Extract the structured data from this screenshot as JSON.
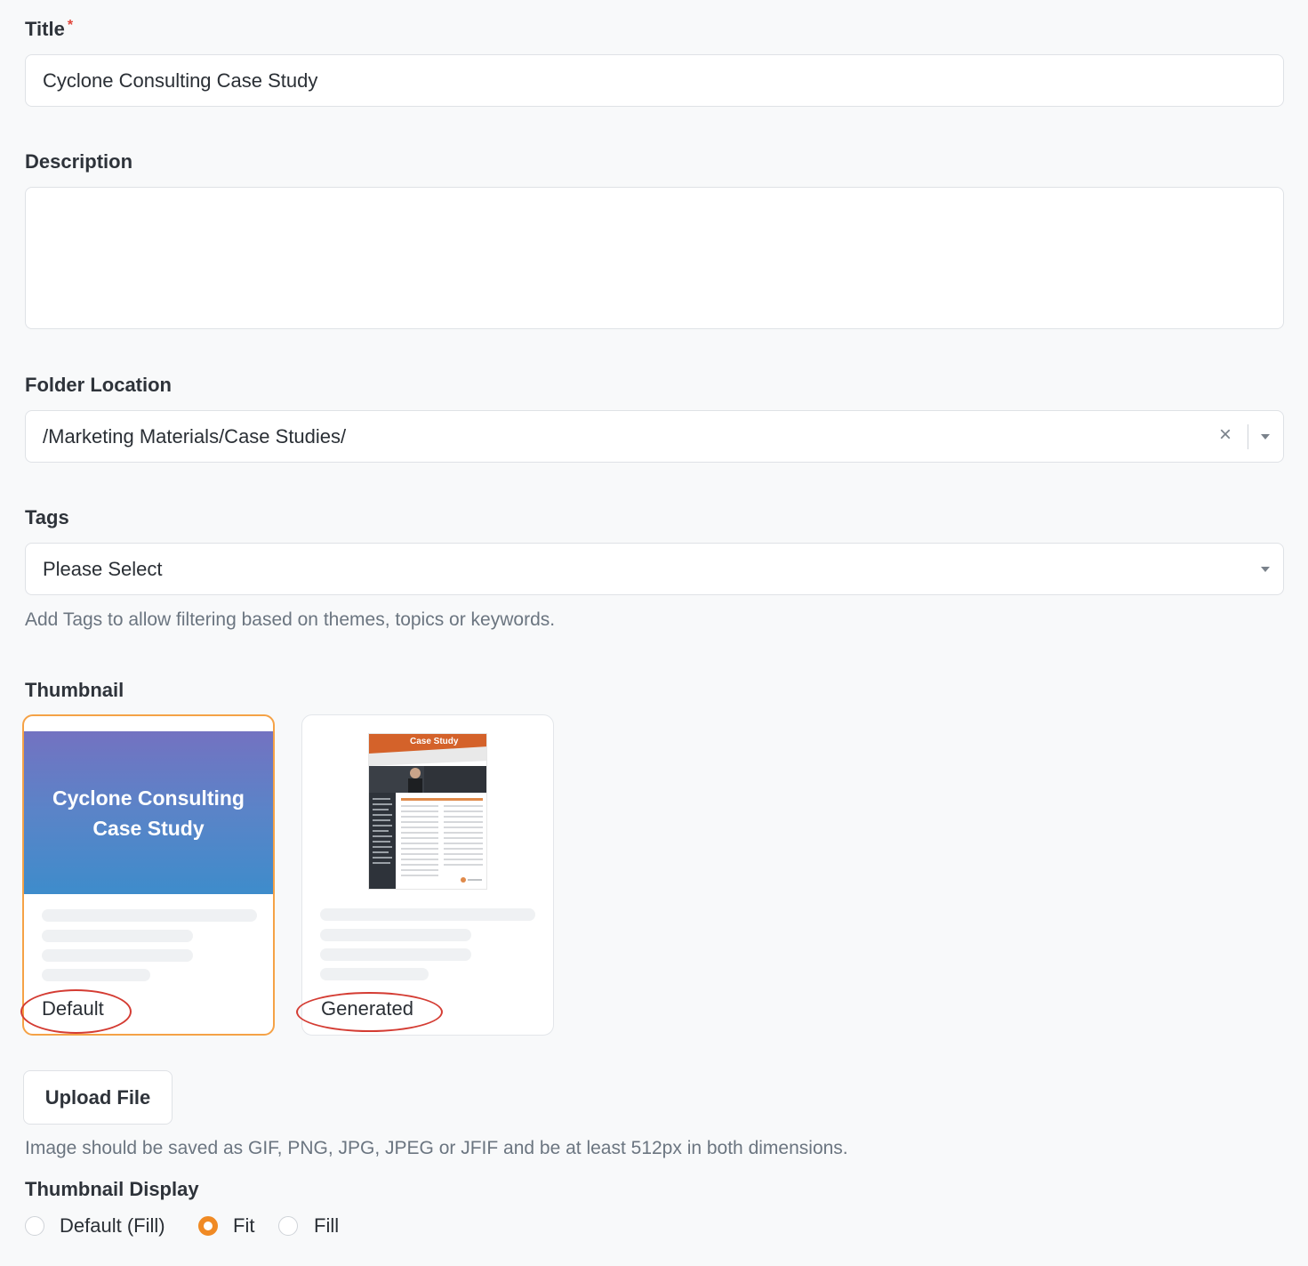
{
  "title": {
    "label": "Title",
    "required_mark": "*",
    "value": "Cyclone Consulting Case Study"
  },
  "description": {
    "label": "Description",
    "value": ""
  },
  "folder": {
    "label": "Folder Location",
    "value": "/Marketing Materials/Case Studies/",
    "clear_glyph": "×"
  },
  "tags": {
    "label": "Tags",
    "placeholder": "Please Select",
    "help": "Add Tags to allow filtering based on themes, topics or keywords."
  },
  "thumbnail": {
    "label": "Thumbnail",
    "options": [
      {
        "label": "Default",
        "banner_line1": "Cyclone Consulting",
        "banner_line2": "Case Study",
        "selected": true
      },
      {
        "label": "Generated",
        "doc_header": "Case Study",
        "selected": false
      }
    ],
    "upload_label": "Upload File",
    "upload_help": "Image should be saved as GIF, PNG, JPG, JPEG or JFIF and be at least 512px in both dimensions."
  },
  "thumbnail_display": {
    "label": "Thumbnail Display",
    "options": [
      {
        "label": "Default (Fill)",
        "checked": false
      },
      {
        "label": "Fit",
        "checked": true
      },
      {
        "label": "Fill",
        "checked": false
      }
    ]
  },
  "colors": {
    "accent": "#f08a24",
    "annotation": "#d43c33",
    "selected_border": "#f5a246"
  },
  "icons": {
    "clear": "close-icon",
    "dropdown": "chevron-down-icon"
  }
}
